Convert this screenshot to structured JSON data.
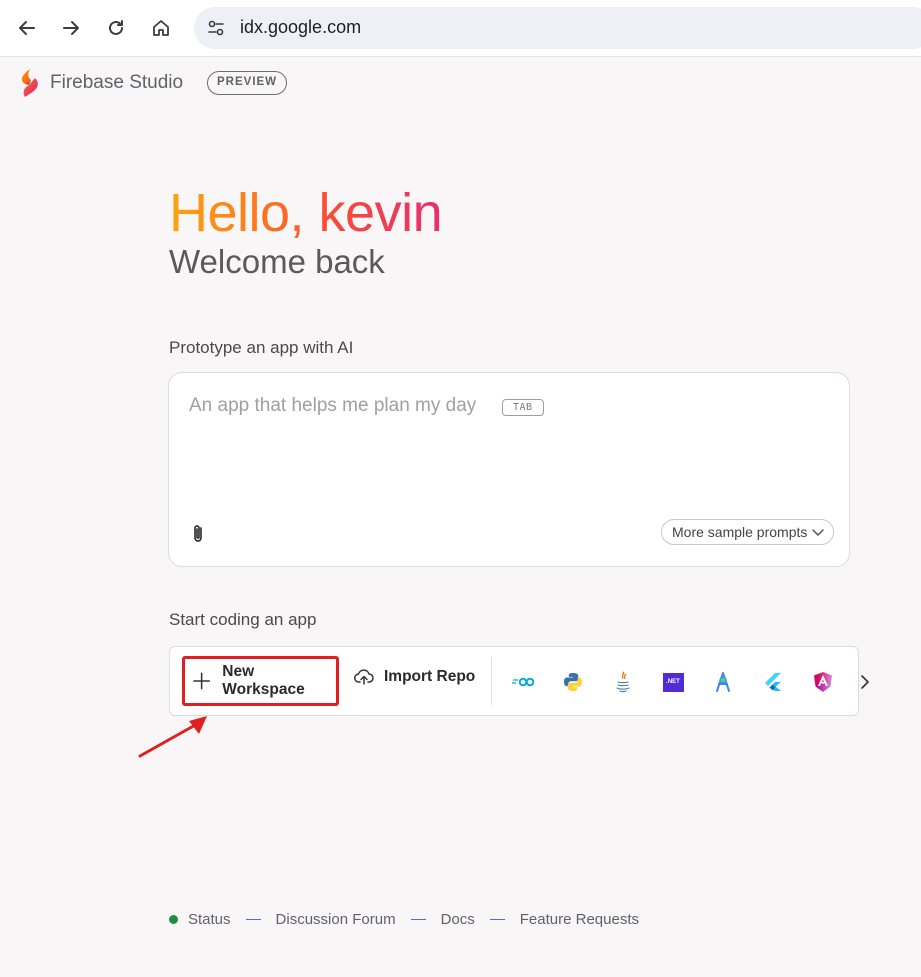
{
  "browser": {
    "url": "idx.google.com"
  },
  "header": {
    "brand": "Firebase Studio",
    "badge": "PREVIEW"
  },
  "hero": {
    "greeting": "Hello, kevin",
    "subtitle": "Welcome back"
  },
  "prototype": {
    "label": "Prototype an app with AI",
    "placeholder": "An app that helps me plan my day",
    "tab_hint": "TAB",
    "more_prompts": "More sample prompts"
  },
  "coding": {
    "label": "Start coding an app",
    "new_workspace": "New Workspace",
    "import_repo": "Import Repo",
    "templates": [
      "go-icon",
      "python-icon",
      "java-icon",
      "dotnet-icon",
      "android-studio-icon",
      "flutter-icon",
      "angular-icon"
    ],
    "dotnet_text": ".NET"
  },
  "footer": {
    "links": [
      "Status",
      "Discussion Forum",
      "Docs",
      "Feature Requests"
    ]
  },
  "colors": {
    "highlight": "#e02020",
    "status_green": "#1e8e3e",
    "hello_gradient_start": "#ffa50f",
    "hello_gradient_end": "#e5306f"
  }
}
